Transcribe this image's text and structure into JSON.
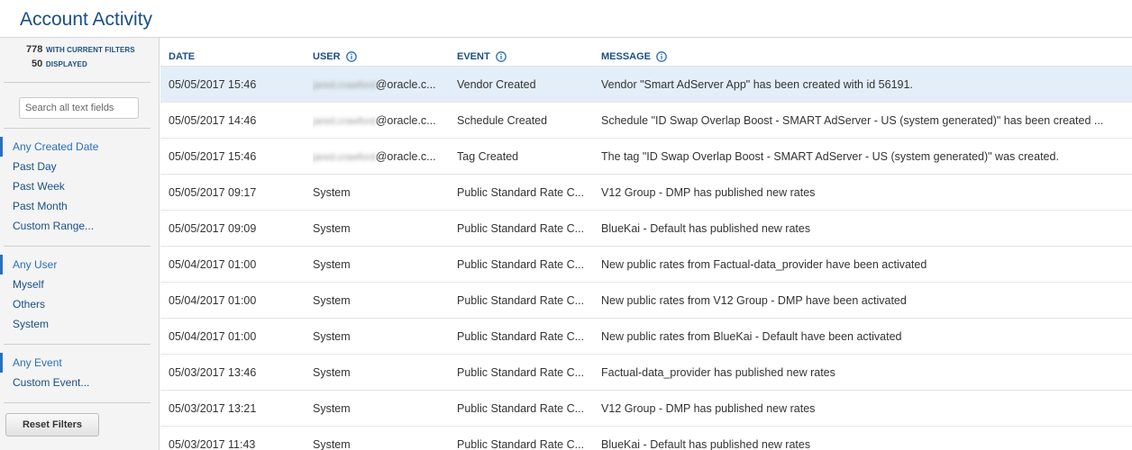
{
  "header": {
    "title": "Account Activity"
  },
  "sidebar": {
    "counts": [
      {
        "num": "778",
        "label": "WITH CURRENT FILTERS"
      },
      {
        "num": "50",
        "label": "DISPLAYED"
      }
    ],
    "search": {
      "placeholder": "Search all text fields",
      "value": ""
    },
    "date_filters": [
      "Any Created Date",
      "Past Day",
      "Past Week",
      "Past Month",
      "Custom Range..."
    ],
    "user_filters": [
      "Any User",
      "Myself",
      "Others",
      "System"
    ],
    "event_filters": [
      "Any Event",
      "Custom Event..."
    ],
    "reset_label": "Reset Filters"
  },
  "table": {
    "columns": [
      "DATE",
      "USER",
      "EVENT",
      "MESSAGE"
    ],
    "rows": [
      {
        "date": "05/05/2017 15:46",
        "user_blur": "jared.crawford",
        "user": "@oracle.c...",
        "event": "Vendor Created",
        "message": "Vendor \"Smart AdServer App\" has been created with id 56191."
      },
      {
        "date": "05/05/2017 14:46",
        "user_blur": "jared.crawford",
        "user": "@oracle.c...",
        "event": "Schedule Created",
        "message": "Schedule \"ID Swap Overlap Boost - SMART AdServer - US (system generated)\" has been created ..."
      },
      {
        "date": "05/05/2017 15:46",
        "user_blur": "jared.crawford",
        "user": "@oracle.c...",
        "event": "Tag Created",
        "message": "The tag \"ID Swap Overlap Boost - SMART AdServer - US (system generated)\" was created."
      },
      {
        "date": "05/05/2017 09:17",
        "user_blur": "",
        "user": "System",
        "event": "Public Standard Rate C...",
        "message": "V12 Group - DMP has published new rates"
      },
      {
        "date": "05/05/2017 09:09",
        "user_blur": "",
        "user": "System",
        "event": "Public Standard Rate C...",
        "message": "BlueKai - Default has published new rates"
      },
      {
        "date": "05/04/2017 01:00",
        "user_blur": "",
        "user": "System",
        "event": "Public Standard Rate C...",
        "message": "New public rates from Factual-data_provider have been activated"
      },
      {
        "date": "05/04/2017 01:00",
        "user_blur": "",
        "user": "System",
        "event": "Public Standard Rate C...",
        "message": "New public rates from V12 Group - DMP have been activated"
      },
      {
        "date": "05/04/2017 01:00",
        "user_blur": "",
        "user": "System",
        "event": "Public Standard Rate C...",
        "message": "New public rates from BlueKai - Default have been activated"
      },
      {
        "date": "05/03/2017 13:46",
        "user_blur": "",
        "user": "System",
        "event": "Public Standard Rate C...",
        "message": "Factual-data_provider has published new rates"
      },
      {
        "date": "05/03/2017 13:21",
        "user_blur": "",
        "user": "System",
        "event": "Public Standard Rate C...",
        "message": "V12 Group - DMP has published new rates"
      },
      {
        "date": "05/03/2017 11:43",
        "user_blur": "",
        "user": "System",
        "event": "Public Standard Rate C...",
        "message": "BlueKai - Default has published new rates"
      }
    ]
  },
  "colors": {
    "accent": "#1a4f86",
    "selected_row": "#e3eef8"
  },
  "icons": {
    "info": "info-circle-icon"
  }
}
